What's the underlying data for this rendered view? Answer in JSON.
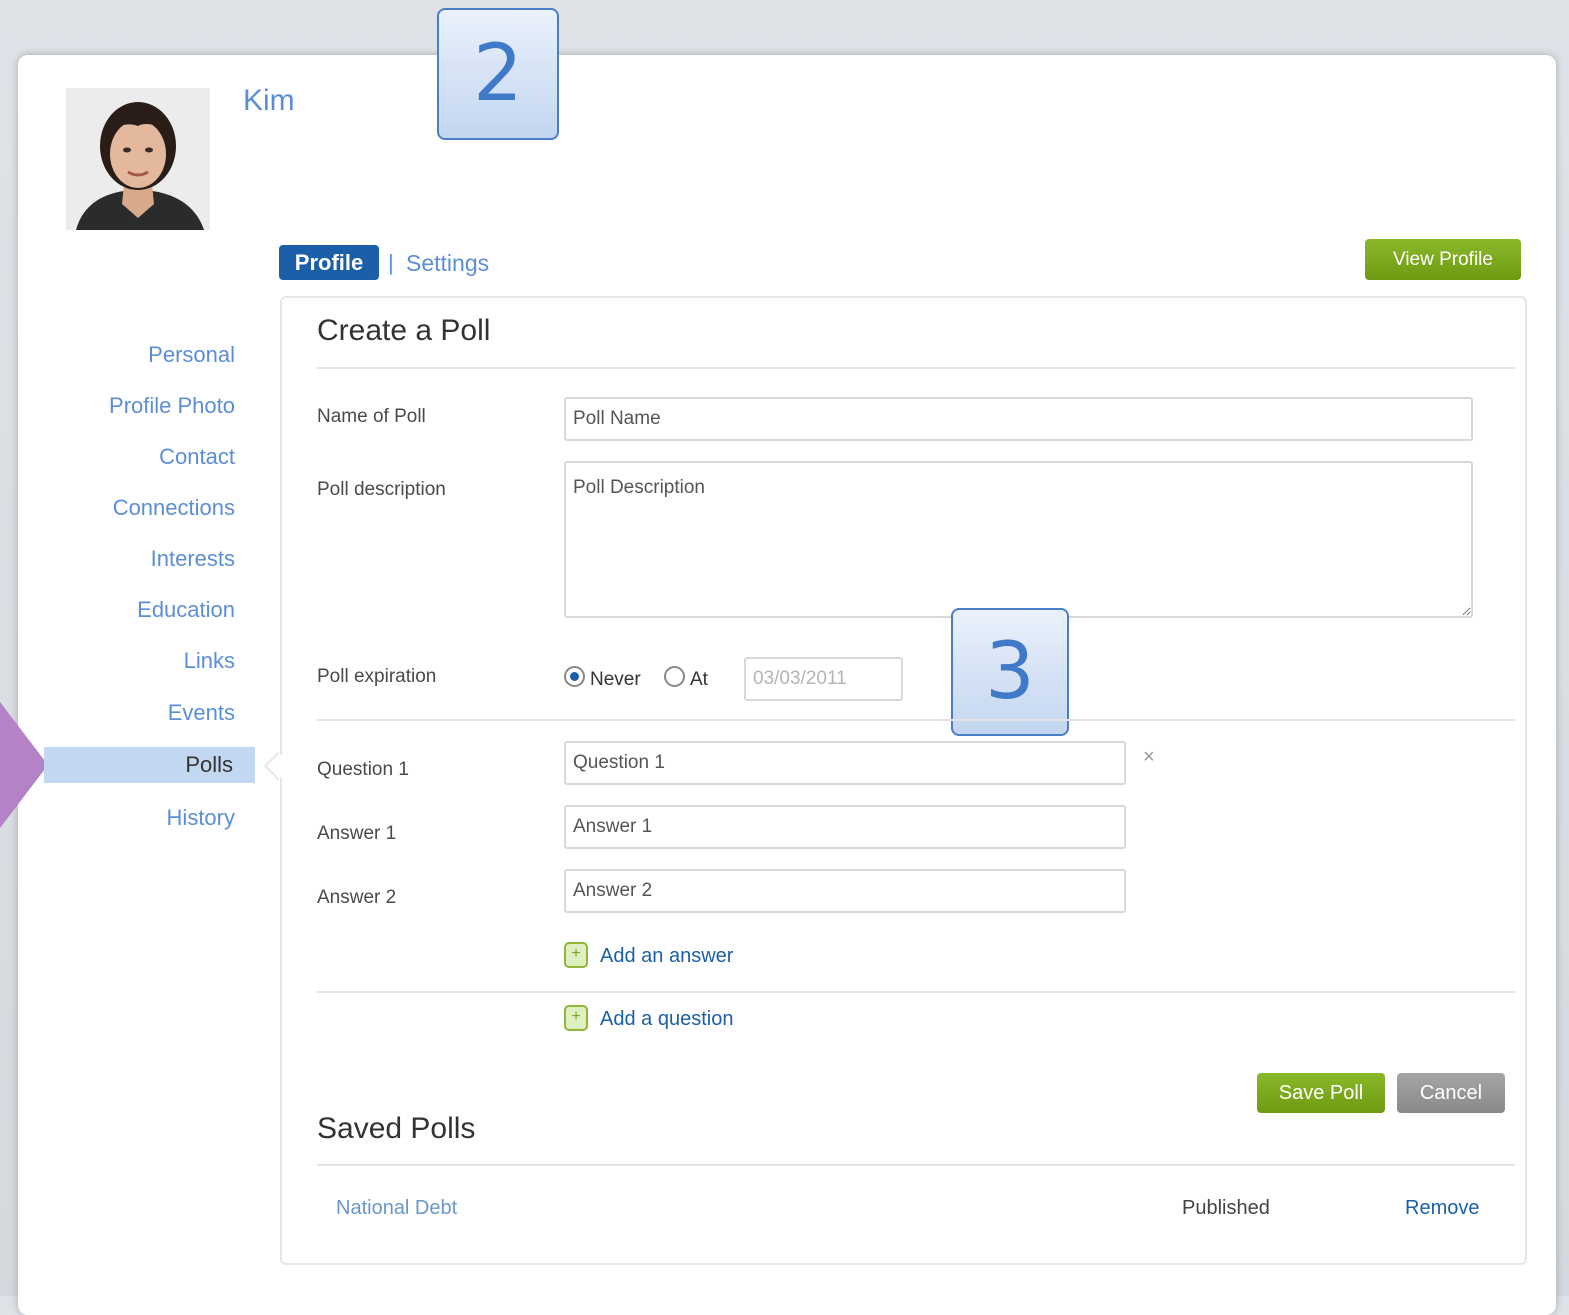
{
  "user": {
    "name": "Kim"
  },
  "callouts": [
    "2",
    "3"
  ],
  "tabs": {
    "profile": "Profile",
    "separator": "|",
    "settings": "Settings"
  },
  "view_profile_button": "View Profile",
  "sidebar": {
    "items": [
      "Personal",
      "Profile Photo",
      "Contact",
      "Connections",
      "Interests",
      "Education",
      "Links",
      "Events",
      "Polls",
      "History"
    ],
    "active": "Polls"
  },
  "create_poll": {
    "title": "Create a Poll",
    "name_label": "Name of Poll",
    "name_placeholder": "Poll Name",
    "description_label": "Poll description",
    "description_placeholder": "Poll Description",
    "expiration_label": "Poll expiration",
    "expiration_options": {
      "never": "Never",
      "at": "At",
      "selected": "Never"
    },
    "expiration_date_placeholder": "03/03/2011",
    "question_label": "Question 1",
    "question_placeholder": "Question 1",
    "answers": [
      {
        "label": "Answer 1",
        "placeholder": "Answer 1"
      },
      {
        "label": "Answer 2",
        "placeholder": "Answer 2"
      }
    ],
    "remove_symbol": "×",
    "plus_symbol": "+",
    "add_answer": "Add an answer",
    "add_question": "Add a question",
    "save_button": "Save Poll",
    "cancel_button": "Cancel"
  },
  "saved_polls": {
    "title": "Saved Polls",
    "rows": [
      {
        "name": "National Debt",
        "status": "Published",
        "action": "Remove"
      }
    ]
  },
  "colors": {
    "link": "#5b8ed6",
    "primary": "#1b5fa8",
    "green_button": "#7aa51e",
    "gray_button": "#999999",
    "pointer": "#b382c7"
  }
}
